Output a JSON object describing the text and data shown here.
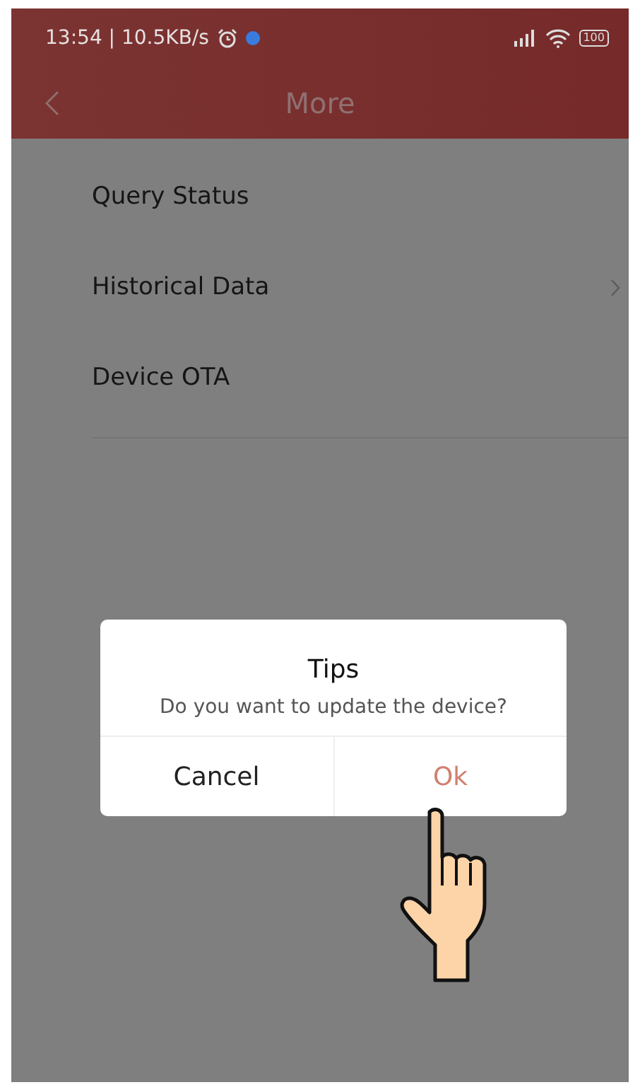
{
  "status_bar": {
    "time": "13:54 | 10.5KB/s",
    "battery": "100"
  },
  "header": {
    "title": "More"
  },
  "menu": [
    {
      "label": "Query Status",
      "chevron": false
    },
    {
      "label": "Historical Data",
      "chevron": true
    },
    {
      "label": "Device OTA",
      "chevron": false
    }
  ],
  "dialog": {
    "title": "Tips",
    "message": "Do you want to update the device?",
    "buttons": [
      {
        "label": "Cancel",
        "kind": "cancel"
      },
      {
        "label": "Ok",
        "kind": "confirm"
      }
    ]
  }
}
